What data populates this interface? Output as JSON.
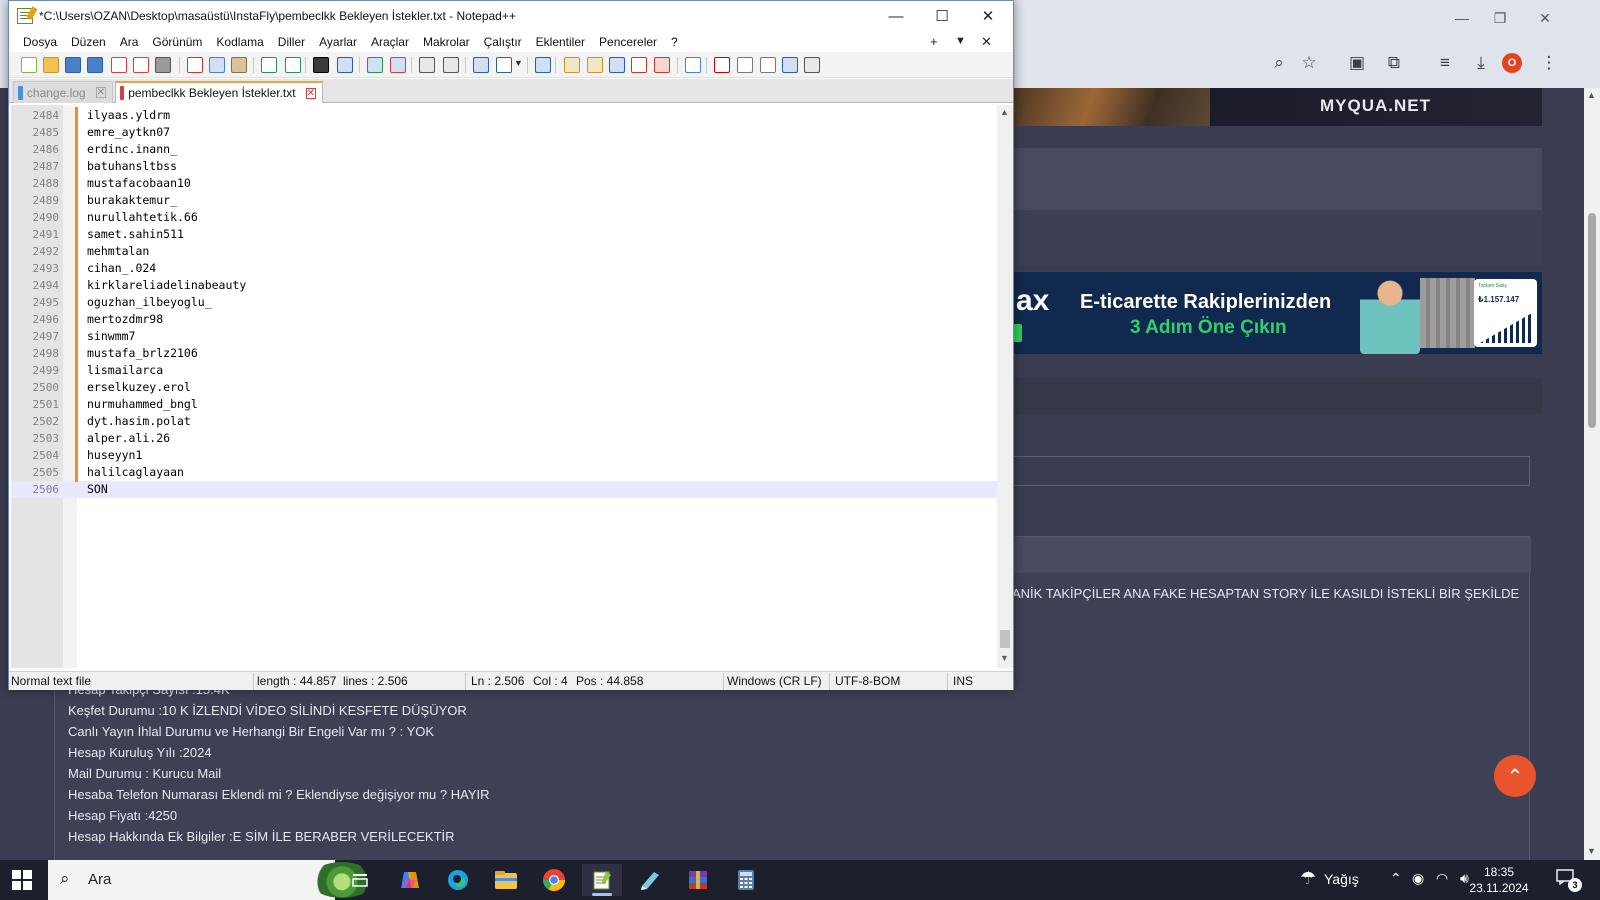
{
  "browser": {
    "window_controls": {
      "minimize": "—",
      "restore": "❐",
      "close": "✕"
    },
    "toolbar_icons": [
      "zoom-icon",
      "star-icon",
      "extension-icon",
      "puzzle-icon",
      "media-icon",
      "download-icon",
      "profile-icon",
      "menu-icon"
    ],
    "profile_initial": "O"
  },
  "webpage": {
    "top_banner_brand": "MYQUA.NET",
    "ad": {
      "logo_fragment": "ax",
      "headline": "E-ticarette Rakiplerinizden",
      "subline": "3 Adım Öne Çıkın",
      "card_label": "Toplam Satış",
      "card_value": "₺1.157.147"
    },
    "description_fragment": "ANİK TAKİPÇİLER ANA FAKE HESAPTAN STORY İLE KASILDI İSTEKLİ BİR ŞEKİLDE",
    "details": [
      "Hesap Takipçi Sayısı :15.4K",
      "Keşfet Durumu :10 K İZLENDİ VİDEO SİLİNDİ KESFETE DÜŞÜYOR",
      "Canlı Yayın İhlal Durumu ve Herhangi Bir Engeli Var mı ? : YOK",
      "Hesap Kuruluş Yılı :2024",
      "Mail Durumu : Kurucu Mail",
      "Hesaba Telefon Numarası Eklendi mi ? Eklendiyse değişiyor mu ? HAYIR",
      "Hesap Fiyatı :4250",
      "Hesap Hakkında Ek Bilgiler :E SİM İLE BERABER VERİLECEKTİR"
    ],
    "scroll_top_icon": "⌃"
  },
  "notepad": {
    "title": "*C:\\Users\\OZAN\\Desktop\\masaüstü\\InstaFly\\pembeclkk Bekleyen İstekler.txt - Notepad++",
    "window_buttons": {
      "minimize": "—",
      "maximize": "☐",
      "close": "✕"
    },
    "menu": [
      "Dosya",
      "Düzen",
      "Ara",
      "Görünüm",
      "Kodlama",
      "Diller",
      "Ayarlar",
      "Araçlar",
      "Makrolar",
      "Çalıştır",
      "Eklentiler",
      "Pencereler",
      "?"
    ],
    "menu_right": {
      "add": "+",
      "dropdown": "▼",
      "close": "✕"
    },
    "tabs": [
      {
        "label": "change.log",
        "active": false
      },
      {
        "label": "pembeclkk Bekleyen İstekler.txt",
        "active": true
      }
    ],
    "lines": [
      {
        "n": "2484",
        "t": "ilyaas.yldrm"
      },
      {
        "n": "2485",
        "t": "emre_aytkn07"
      },
      {
        "n": "2486",
        "t": "erdinc.inann_"
      },
      {
        "n": "2487",
        "t": "batuhansltbss"
      },
      {
        "n": "2488",
        "t": "mustafacobaan10"
      },
      {
        "n": "2489",
        "t": "burakaktemur_"
      },
      {
        "n": "2490",
        "t": "nurullahtetik.66"
      },
      {
        "n": "2491",
        "t": "samet.sahin511"
      },
      {
        "n": "2492",
        "t": "mehmtalan"
      },
      {
        "n": "2493",
        "t": "cihan_.024"
      },
      {
        "n": "2494",
        "t": "kirklareliadelinabeauty"
      },
      {
        "n": "2495",
        "t": "oguzhan_ilbeyoglu_"
      },
      {
        "n": "2496",
        "t": "mertozdmr98"
      },
      {
        "n": "2497",
        "t": "sinwmm7"
      },
      {
        "n": "2498",
        "t": "mustafa_brlz2106"
      },
      {
        "n": "2499",
        "t": "lismailarca"
      },
      {
        "n": "2500",
        "t": "erselkuzey.erol"
      },
      {
        "n": "2501",
        "t": "nurmuhammed_bngl"
      },
      {
        "n": "2502",
        "t": "dyt.hasim.polat"
      },
      {
        "n": "2503",
        "t": "alper.ali.26"
      },
      {
        "n": "2504",
        "t": "huseyyn1"
      },
      {
        "n": "2505",
        "t": "halilcaglayaan"
      },
      {
        "n": "2506",
        "t": "SON"
      }
    ],
    "current_line": "2506",
    "status": {
      "file_type": "Normal text file",
      "length": "length : 44.857",
      "lines": "lines : 2.506",
      "ln": "Ln : 2.506",
      "col": "Col : 4",
      "pos": "Pos : 44.858",
      "eol": "Windows (CR LF)",
      "encoding": "UTF-8-BOM",
      "mode": "INS"
    }
  },
  "taskbar": {
    "search_placeholder": "Ara",
    "weather": "Yağış",
    "time": "18:35",
    "date": "23.11.2024",
    "notification_count": "3",
    "apps": [
      "task-view-icon",
      "copilot-icon",
      "edge-icon",
      "file-explorer-icon",
      "chrome-icon",
      "notepadpp-icon",
      "notes-icon",
      "winrar-icon",
      "calculator-icon"
    ],
    "colors": {
      "chrome": "#ea4335",
      "edge": "#1fa0e0",
      "explorer": "#f2c14e"
    }
  }
}
